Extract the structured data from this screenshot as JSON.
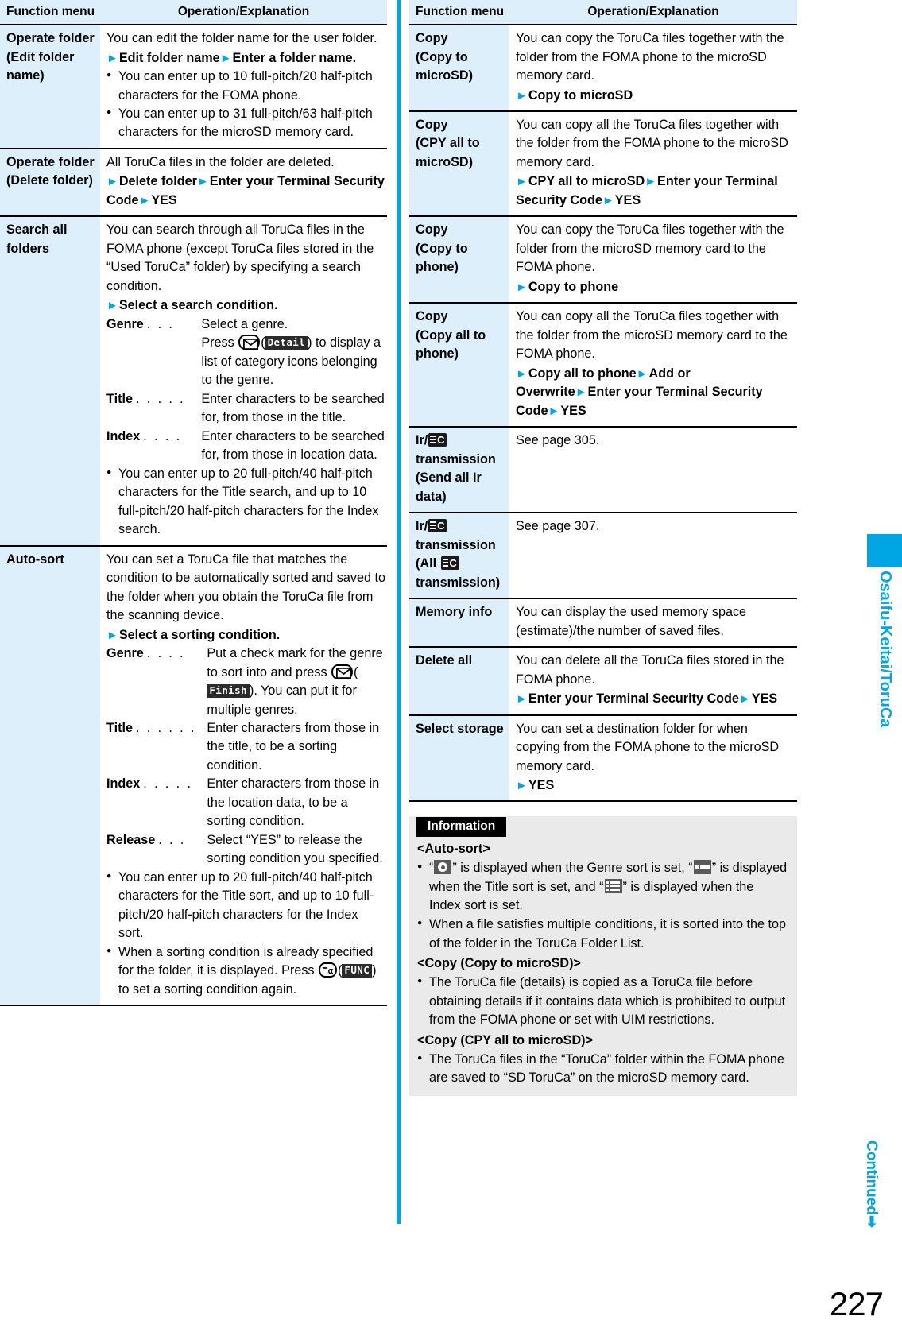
{
  "page": {
    "number": "227",
    "continued_label": "Continued",
    "continued_arrow": "➡",
    "side_tab_label": "Osaifu-Keitai/ToruCa",
    "accent_color": "#00a5e3",
    "menu_col_bg": "#ddeffa",
    "info_bg": "#eaeaea"
  },
  "table_headers": {
    "function_menu": "Function menu",
    "operation": "Operation/Explanation"
  },
  "left_column": {
    "rows": [
      {
        "menu": "Operate folder (Edit folder name)",
        "menu_lines": [
          "Operate folder",
          "(Edit folder",
          "name)"
        ],
        "intro": "You can edit the folder name for the user folder.",
        "steps": [
          {
            "parts": [
              "Edit folder name",
              "Enter a folder name."
            ]
          }
        ],
        "bullets": [
          "You can enter up to 10 full-pitch/20 half-pitch characters for the FOMA phone.",
          "You can enter up to 31 full-pitch/63 half-pitch characters for the microSD memory card."
        ]
      },
      {
        "menu": "Operate folder (Delete folder)",
        "menu_lines": [
          "Operate folder",
          "(Delete folder)"
        ],
        "intro": "All ToruCa files in the folder are deleted.",
        "steps": [
          {
            "parts": [
              "Delete folder",
              "Enter your Terminal Security Code",
              "YES"
            ]
          }
        ],
        "bullets": []
      },
      {
        "menu": "Search all folders",
        "menu_lines": [
          "Search all",
          "folders"
        ],
        "intro": "You can search through all ToruCa files in the FOMA phone (except ToruCa files stored in the “Used ToruCa” folder) by specifying a search condition.",
        "steps": [
          {
            "parts": [
              "Select a search condition."
            ]
          }
        ],
        "definitions": [
          {
            "label": "Genre",
            "dots": ". . .",
            "text": "Select a genre.",
            "continuation": [
              {
                "pre": "Press ",
                "key": "envelope-key",
                "mid": "(",
                "softkey": "Detail",
                "post": ") to display a list of category icons belonging to the genre."
              }
            ]
          },
          {
            "label": "Title",
            "dots": ". . . . .",
            "text": "Enter characters to be searched for, from those in the title."
          },
          {
            "label": "Index",
            "dots": ". . . .",
            "text": "Enter characters to be searched for, from those in location data."
          }
        ],
        "bullets": [
          "You can enter up to 20 full-pitch/40 half-pitch characters for the Title search, and up to 10 full-pitch/20 half-pitch characters for the Index search."
        ]
      },
      {
        "menu": "Auto-sort",
        "menu_lines": [
          "Auto-sort"
        ],
        "intro": "You can set a ToruCa file that matches the condition to be automatically sorted and saved to the folder when you obtain the ToruCa file from the scanning device.",
        "steps": [
          {
            "parts": [
              "Select a sorting condition."
            ]
          }
        ],
        "definitions": [
          {
            "label": "Genre",
            "dots": ". . . .",
            "text_pre": "Put a check mark for the genre to sort into and press ",
            "key": "envelope-key",
            "mid": "(",
            "softkey": "Finish",
            "text_post": "). You can put it for multiple genres."
          },
          {
            "label": "Title",
            "dots": ". . . . . .",
            "text": "Enter characters from those in the title, to be a sorting condition."
          },
          {
            "label": "Index",
            "dots": ". . . . .",
            "text": "Enter characters from those in the location data, to be a sorting condition."
          },
          {
            "label": "Release",
            "dots": ". . .",
            "text": "Select “YES” to release the sorting condition you specified."
          }
        ],
        "bullets": [
          "You can enter up to 20 full-pitch/40 half-pitch characters for the Title sort, and up to 10 full-pitch/20 half-pitch characters for the Index sort.",
          "When a sorting condition is already specified for the folder, it is displayed. Press FUNC-key(FUNC) to set a sorting condition again."
        ],
        "last_bullet": {
          "pre": "When a sorting condition is already specified for the folder, it is displayed. Press ",
          "key": "func-key",
          "mid": "(",
          "softkey": "FUNC",
          "post": ") to set a sorting condition again."
        }
      }
    ]
  },
  "right_column": {
    "rows": [
      {
        "menu_lines": [
          "Copy",
          "(Copy to",
          "microSD)"
        ],
        "intro": "You can copy the ToruCa files together with the folder from the FOMA phone to the microSD memory card.",
        "steps": [
          {
            "parts": [
              "Copy to microSD"
            ]
          }
        ]
      },
      {
        "menu_lines": [
          "Copy",
          "(CPY all to",
          "microSD)"
        ],
        "intro": "You can copy all the ToruCa files together with the folder from the FOMA phone to the microSD memory card.",
        "steps": [
          {
            "parts": [
              "CPY all to microSD",
              "Enter your Terminal Security Code",
              "YES"
            ]
          }
        ]
      },
      {
        "menu_lines": [
          "Copy",
          "(Copy to",
          "phone)"
        ],
        "intro": "You can copy the ToruCa files together with the folder from the microSD memory card to the FOMA phone.",
        "steps": [
          {
            "parts": [
              "Copy to phone"
            ]
          }
        ]
      },
      {
        "menu_lines": [
          "Copy",
          "(Copy all to",
          "phone)"
        ],
        "intro": "You can copy all the ToruCa files together with the folder from the microSD memory card to the FOMA phone.",
        "steps": [
          {
            "parts": [
              "Copy all to phone",
              "Add or Overwrite",
              "Enter your Terminal Security Code",
              "YES"
            ]
          }
        ]
      },
      {
        "menu_ir_1": "Ir/",
        "menu_ir_icon": "ic-icon",
        "menu_ir_2": "transmission",
        "menu_ir_3": "(Send all Ir data)",
        "intro": "See page 305.",
        "steps": []
      },
      {
        "menu_ir_1": "Ir/",
        "menu_ir_icon": "ic-icon",
        "menu_ir_2": "transmission",
        "menu_ir_3a": "(All ",
        "menu_ir_3b": "transmission)",
        "intro": "See page 307.",
        "steps": []
      },
      {
        "menu_lines": [
          "Memory info"
        ],
        "intro": "You can display the used memory space (estimate)/the number of saved files.",
        "steps": []
      },
      {
        "menu_lines": [
          "Delete all"
        ],
        "intro": "You can delete all the ToruCa files stored in the FOMA phone.",
        "steps": [
          {
            "parts": [
              "Enter your Terminal Security Code",
              "YES"
            ]
          }
        ]
      },
      {
        "menu_lines": [
          "Select storage"
        ],
        "intro": "You can set a destination folder for when copying from the FOMA phone to the microSD memory card.",
        "steps": [
          {
            "parts": [
              "YES"
            ]
          }
        ]
      }
    ],
    "information": {
      "tab_label": "Information",
      "sections": [
        {
          "heading": "<Auto-sort>",
          "bullets": [
            {
              "icon_sentence": true,
              "p1": "“",
              "icon1": "genre-sort-icon",
              "p2": "” is displayed when the Genre sort is set, “",
              "icon2": "title-sort-icon",
              "p3": "” is displayed when the Title sort is set, and “",
              "icon3": "index-sort-icon",
              "p4": "” is displayed when the Index sort is set."
            },
            {
              "text": "When a file satisfies multiple conditions, it is sorted into the top of the folder in the ToruCa Folder List."
            }
          ]
        },
        {
          "heading": "<Copy (Copy to microSD)>",
          "bullets": [
            {
              "text": "The ToruCa file (details) is copied as a ToruCa file before obtaining details if it contains data which is prohibited to output from the FOMA phone or set with UIM restrictions."
            }
          ]
        },
        {
          "heading": "<Copy (CPY all to microSD)>",
          "bullets": [
            {
              "text": "The ToruCa files in the “ToruCa” folder within the FOMA phone are saved to “SD ToruCa” on the microSD memory card."
            }
          ]
        }
      ]
    }
  }
}
